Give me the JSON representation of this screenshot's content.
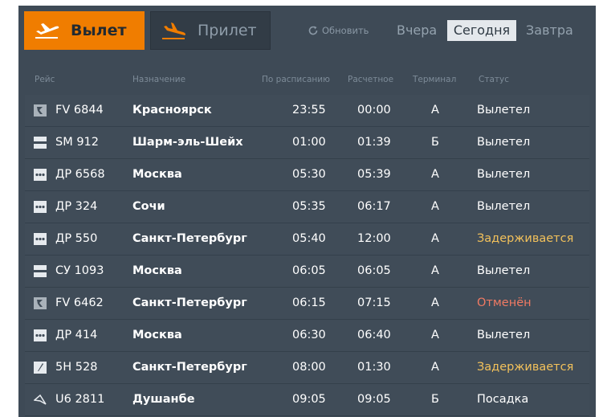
{
  "header": {
    "departures_label": "Вылет",
    "arrivals_label": "Прилет",
    "refresh_label": "Обновить",
    "days": {
      "yesterday": "Вчера",
      "today": "Сегодня",
      "tomorrow": "Завтра"
    },
    "active_tab": "departures",
    "active_day": "today"
  },
  "columns": {
    "flight": "Рейс",
    "destination": "Назначение",
    "scheduled": "По расписанию",
    "estimated": "Расчетное",
    "terminal": "Терминал",
    "status": "Статус"
  },
  "colors": {
    "accent": "#f07d00",
    "board_bg": "#3e4a56",
    "status_delayed": "#f2c15b",
    "status_cancelled": "#f07a63"
  },
  "flights": [
    {
      "logo": "airline-logo-r",
      "flight": "FV 6844",
      "destination": "Красноярск",
      "scheduled": "23:55",
      "estimated": "00:00",
      "terminal": "A",
      "status": "Вылетел",
      "status_kind": "ok"
    },
    {
      "logo": "airline-logo-stripe",
      "flight": "SM 912",
      "destination": "Шарм-эль-Шейх",
      "scheduled": "01:00",
      "estimated": "01:39",
      "terminal": "Б",
      "status": "Вылетел",
      "status_kind": "ok"
    },
    {
      "logo": "airline-logo-dots",
      "flight": "ДР 6568",
      "destination": "Москва",
      "scheduled": "05:30",
      "estimated": "05:39",
      "terminal": "A",
      "status": "Вылетел",
      "status_kind": "ok"
    },
    {
      "logo": "airline-logo-dots",
      "flight": "ДР 324",
      "destination": "Сочи",
      "scheduled": "05:35",
      "estimated": "06:17",
      "terminal": "A",
      "status": "Вылетел",
      "status_kind": "ok"
    },
    {
      "logo": "airline-logo-dots",
      "flight": "ДР 550",
      "destination": "Санкт-Петербург",
      "scheduled": "05:40",
      "estimated": "12:00",
      "terminal": "A",
      "status": "Задерживается",
      "status_kind": "delay"
    },
    {
      "logo": "airline-logo-stripe",
      "flight": "СУ 1093",
      "destination": "Москва",
      "scheduled": "06:05",
      "estimated": "06:05",
      "terminal": "A",
      "status": "Вылетел",
      "status_kind": "ok"
    },
    {
      "logo": "airline-logo-r",
      "flight": "FV 6462",
      "destination": "Санкт-Петербург",
      "scheduled": "06:15",
      "estimated": "07:15",
      "terminal": "A",
      "status": "Отменён",
      "status_kind": "cancel"
    },
    {
      "logo": "airline-logo-dots",
      "flight": "ДР 414",
      "destination": "Москва",
      "scheduled": "06:30",
      "estimated": "06:40",
      "terminal": "A",
      "status": "Вылетел",
      "status_kind": "ok"
    },
    {
      "logo": "airline-logo-feather",
      "flight": "5Н 528",
      "destination": "Санкт-Петербург",
      "scheduled": "08:00",
      "estimated": "01:30",
      "terminal": "A",
      "status": "Задерживается",
      "status_kind": "delay"
    },
    {
      "logo": "airline-logo-wing",
      "flight": "U6 2811",
      "destination": "Душанбе",
      "scheduled": "09:05",
      "estimated": "09:05",
      "terminal": "Б",
      "status": "Посадка",
      "status_kind": "ok"
    }
  ]
}
